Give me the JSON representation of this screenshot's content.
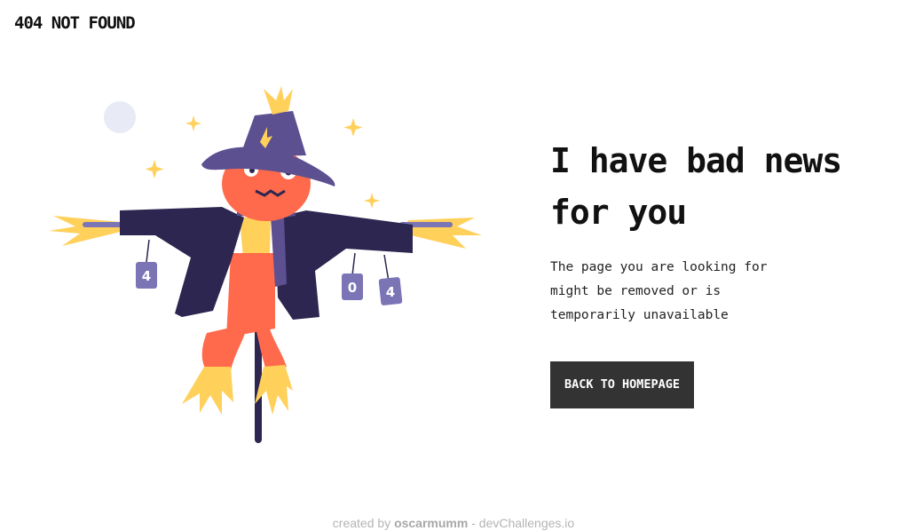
{
  "brand": {
    "logo_text": "404 NOT FOUND"
  },
  "hero": {
    "headline": "I have bad news for you",
    "message": "The page you are looking for might be removed or is temporarily unavailable",
    "cta_label": "BACK TO HOMEPAGE"
  },
  "illustration": {
    "can_labels": [
      "4",
      "0",
      "4"
    ],
    "icons": [
      "scarecrow-illustration",
      "moon-icon",
      "sparkle-icon"
    ]
  },
  "footer": {
    "prefix": "created by",
    "author": "oscarmumm",
    "separator": "-",
    "site": "devChallenges.io"
  },
  "colors": {
    "cta_background": "#333333",
    "hat": "#5c5091",
    "coat": "#2c2650",
    "face": "#ff6a4d",
    "straw": "#ffd05a",
    "can": "#7b74b5"
  }
}
